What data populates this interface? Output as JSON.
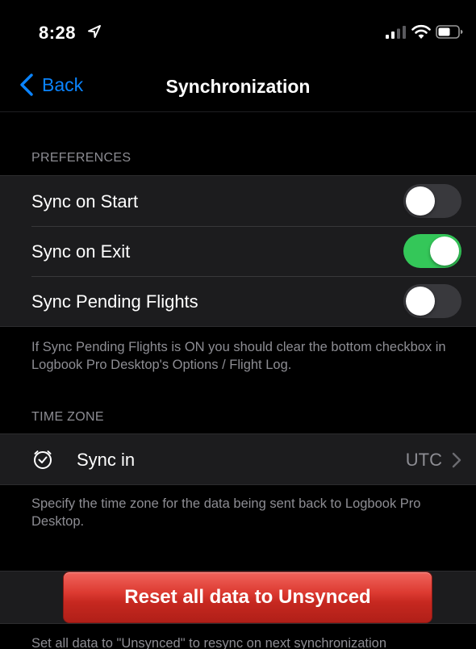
{
  "status_bar": {
    "time": "8:28",
    "icons": [
      "location-arrow-icon",
      "cellular-signal-icon",
      "wifi-icon",
      "battery-icon"
    ]
  },
  "nav": {
    "back_label": "Back",
    "title": "Synchronization",
    "accent_color": "#0a84ff"
  },
  "preferences": {
    "header": "PREFERENCES",
    "items": [
      {
        "label": "Sync on Start",
        "on": false
      },
      {
        "label": "Sync on Exit",
        "on": true
      },
      {
        "label": "Sync Pending Flights",
        "on": false
      }
    ],
    "footer": "If Sync Pending Flights is ON you should clear the bottom checkbox in Logbook Pro Desktop's Options / Flight Log.",
    "toggle_on_color": "#34c759"
  },
  "time_zone": {
    "header": "TIME ZONE",
    "row": {
      "icon": "clock-icon",
      "label": "Sync in",
      "value": "UTC"
    },
    "footer": "Specify the time zone for the data being sent back to Logbook Pro Desktop."
  },
  "reset": {
    "button_label": "Reset all data to Unsynced",
    "button_color": "#d8342b",
    "footer": "Set all data to \"Unsynced\" to resync on next synchronization"
  }
}
